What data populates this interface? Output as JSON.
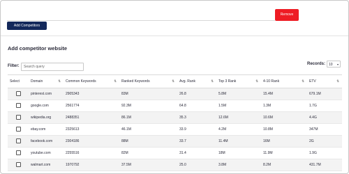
{
  "form": {
    "url_value": "",
    "remove_label": "Remove",
    "add_label": "Add Competitors"
  },
  "section_title": "Add competitor website",
  "filter": {
    "label": "Filter:",
    "placeholder": "Search query"
  },
  "records": {
    "label": "Records:",
    "value": "10"
  },
  "table": {
    "headers": [
      "Select",
      "Domain",
      "Common Keywords",
      "Ranked Keywords",
      "Avg. Rank",
      "Top 3 Rank",
      "4-10 Rank",
      "ETV"
    ],
    "sortable": [
      false,
      true,
      true,
      true,
      true,
      true,
      true,
      true
    ],
    "rows": [
      {
        "domain": "pinterest.com",
        "common": "2905343",
        "ranked": "83M",
        "avg": "26.8",
        "top3": "5.8M",
        "r410": "15.4M",
        "etv": "679.1M"
      },
      {
        "domain": "google.com",
        "common": "2561774",
        "ranked": "92.3M",
        "avg": "64.8",
        "top3": "1.5M",
        "r410": "1.3M",
        "etv": "1.7G"
      },
      {
        "domain": "wikipedia.org",
        "common": "2488351",
        "ranked": "86.1M",
        "avg": "35.3",
        "top3": "12.6M",
        "r410": "10.6M",
        "etv": "4.4G"
      },
      {
        "domain": "ebay.com",
        "common": "2325613",
        "ranked": "46.1M",
        "avg": "33.9",
        "top3": "4.2M",
        "r410": "10.8M",
        "etv": "347M"
      },
      {
        "domain": "facebook.com",
        "common": "2304186",
        "ranked": "88M",
        "avg": "33.7",
        "top3": "11.4M",
        "r410": "16M",
        "etv": "2G"
      },
      {
        "domain": "youtube.com",
        "common": "2255516",
        "ranked": "82M",
        "avg": "31.4",
        "top3": "18M",
        "r410": "11.9M",
        "etv": "1.9G"
      },
      {
        "domain": "walmart.com",
        "common": "1970792",
        "ranked": "37.5M",
        "avg": "25.0",
        "top3": "3.8M",
        "r410": "8.2M",
        "etv": "431.7M"
      }
    ]
  },
  "colors": {
    "remove": "#ee1c24",
    "primary": "#13285a",
    "row_alt": "#f3f3f3"
  },
  "icons": {
    "sort": "sort-arrows-icon",
    "dropdown": "chevron-down-icon"
  }
}
